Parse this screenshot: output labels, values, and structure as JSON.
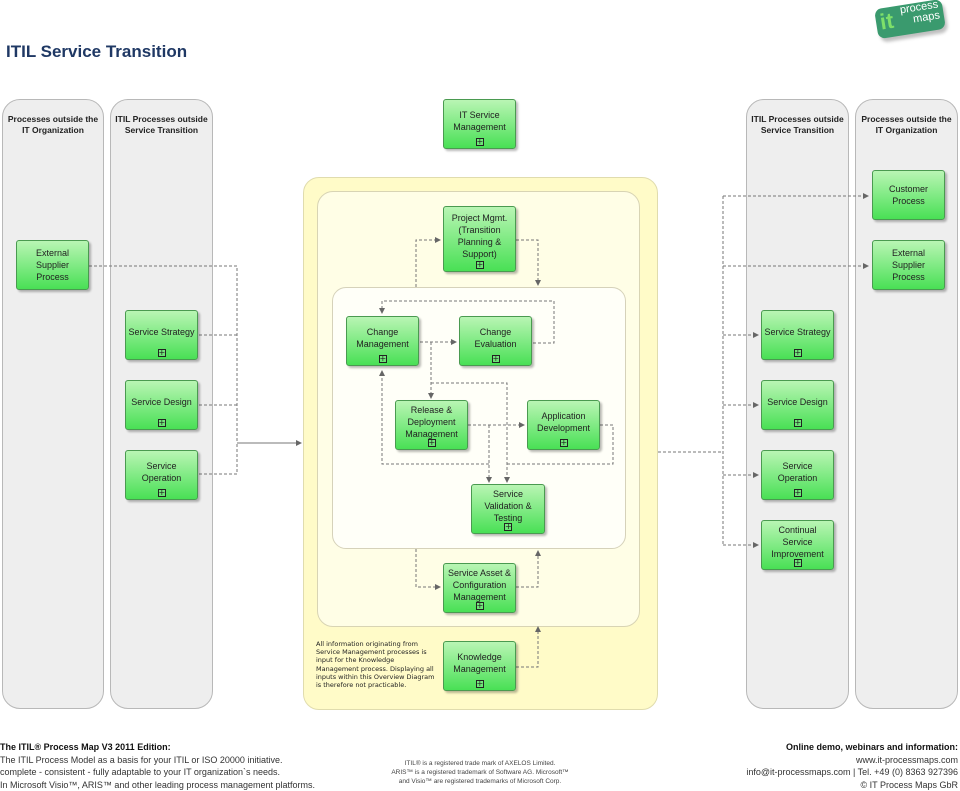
{
  "page_title": "ITIL Service Transition",
  "logo": {
    "it": "it",
    "process": "process",
    "maps": "maps"
  },
  "lanes": {
    "left_outer": "Processes outside the\nIT Organization",
    "left_inner": "ITIL Processes outside\nService Transition",
    "right_inner": "ITIL Processes outside\nService Transition",
    "right_outer": "Processes outside the\nIT Organization"
  },
  "boxes": {
    "left_external_supplier": "External\nSupplier Process",
    "left_service_strategy": "Service Strategy",
    "left_service_design": "Service Design",
    "left_service_operation": "Service\nOperation",
    "it_service_management": "IT Service\nManagement",
    "project_mgmt": "Project Mgmt.\n(Transition\nPlanning &\nSupport)",
    "change_management": "Change\nManagement",
    "change_evaluation": "Change\nEvaluation",
    "release_deployment": "Release &\nDeployment\nManagement",
    "application_development": "Application\nDevelopment",
    "service_validation": "Service\nValidation &\nTesting",
    "service_asset_config": "Service Asset &\nConfiguration\nManagement",
    "knowledge_management": "Knowledge\nManagement",
    "right_customer_process": "Customer\nProcess",
    "right_external_supplier": "External\nSupplier Process",
    "right_service_strategy": "Service Strategy",
    "right_service_design": "Service Design",
    "right_service_operation": "Service\nOperation",
    "right_csi": "Continual\nService\nImprovement"
  },
  "expand_symbol": "+",
  "note": "All information originating from Service Management processes is input for the Knowledge Management process. Displaying all inputs within this Overview Diagram is therefore not practicable.",
  "footer": {
    "left_heading": "The ITIL® Process Map V3 2011 Edition:",
    "left_line1": "The ITIL Process Model as a basis for your ITIL or ISO 20000 initiative.",
    "left_line2": "complete - consistent - fully adaptable to your IT organization`s needs.",
    "left_line3": "In Microsoft Visio™, ARIS™ and other leading process management platforms.",
    "mid_line1": "ITIL® is a registered trade mark of AXELOS Limited.",
    "mid_line2": "ARIS™ is a  registered trademark of Software AG. Microsoft™",
    "mid_line3": "and Visio™ are registered trademarks of Microsoft Corp.",
    "right_heading": "Online demo, webinars and information:",
    "right_line1": "www.it-processmaps.com",
    "right_line2": "info@it-processmaps.com | Tel. +49 (0) 8363 927396",
    "right_line3": "© IT Process Maps GbR"
  },
  "colors": {
    "title": "#1f3864",
    "box_top": "#b9f5b4",
    "box_bottom": "#49e055",
    "lane_bg": "#eeeeee",
    "yellow_bg": "#fffbc8",
    "logo_bg": "#3a9a6e"
  }
}
